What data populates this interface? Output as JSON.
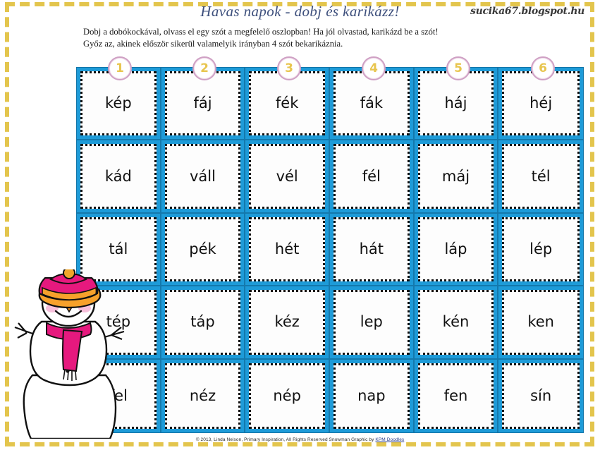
{
  "header": {
    "title": "Havas napok - dobj és karikázz!",
    "watermark": "sucika67.blogspot.hu",
    "instruction_line1": "Dobj a dobókockával, olvass el egy szót a megfelelő oszlopban! Ha jól olvastad, karikázd be a szót!",
    "instruction_line2": "Győz az, akinek először sikerül valamelyik irányban 4 szót bekarikáznia."
  },
  "colors": {
    "grid_blue": "#1e9bd8",
    "grid_divider": "#1479ad",
    "border_gold": "#e3c54d",
    "circle_ring": "#cfa0c4",
    "circle_number": "#e8c54e",
    "title_blue": "#3d4f7c"
  },
  "board": {
    "column_numbers": [
      "1",
      "2",
      "3",
      "4",
      "5",
      "6"
    ],
    "rows": [
      [
        "kép",
        "fáj",
        "fék",
        "fák",
        "háj",
        "héj"
      ],
      [
        "kád",
        "váll",
        "vél",
        "fél",
        "máj",
        "tél"
      ],
      [
        "tál",
        "pék",
        "hét",
        "hát",
        "láp",
        "lép"
      ],
      [
        "tép",
        "táp",
        "kéz",
        "lep",
        "kén",
        "ken"
      ],
      [
        "fel",
        "néz",
        "nép",
        "nap",
        "fen",
        "sín"
      ]
    ]
  },
  "footer": {
    "credit_text": "© 2013, Linda Nelson, Primary Inspiration, All Rights Reserved   Snowman Graphic by ",
    "credit_link": "KPM Doodles"
  }
}
